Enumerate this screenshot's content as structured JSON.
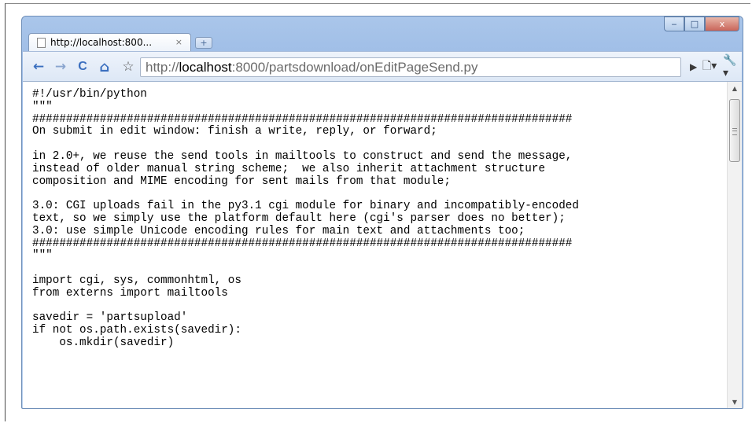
{
  "tab": {
    "title": "http://localhost:800...",
    "close": "×",
    "new_tab": "+"
  },
  "window_controls": {
    "minimize": "‒",
    "maximize": "□",
    "close": "x"
  },
  "toolbar": {
    "back": "←",
    "forward": "→",
    "reload": "C",
    "home": "⌂",
    "bookmark": "☆",
    "url_scheme": "http://",
    "url_host": "localhost",
    "url_rest": ":8000/partsdownload/onEditPageSend.py",
    "go": "▶",
    "page_menu": "🗋▾",
    "tools_menu": "🔧▾"
  },
  "content": {
    "lines": [
      "#!/usr/bin/python",
      "\"\"\"",
      "################################################################################",
      "On submit in edit window: finish a write, reply, or forward;",
      "",
      "in 2.0+, we reuse the send tools in mailtools to construct and send the message,",
      "instead of older manual string scheme;  we also inherit attachment structure",
      "composition and MIME encoding for sent mails from that module;",
      "",
      "3.0: CGI uploads fail in the py3.1 cgi module for binary and incompatibly-encoded",
      "text, so we simply use the platform default here (cgi's parser does no better);",
      "3.0: use simple Unicode encoding rules for main text and attachments too;",
      "################################################################################",
      "\"\"\"",
      "",
      "import cgi, sys, commonhtml, os",
      "from externs import mailtools",
      "",
      "savedir = 'partsupload'",
      "if not os.path.exists(savedir):",
      "    os.mkdir(savedir)"
    ]
  }
}
